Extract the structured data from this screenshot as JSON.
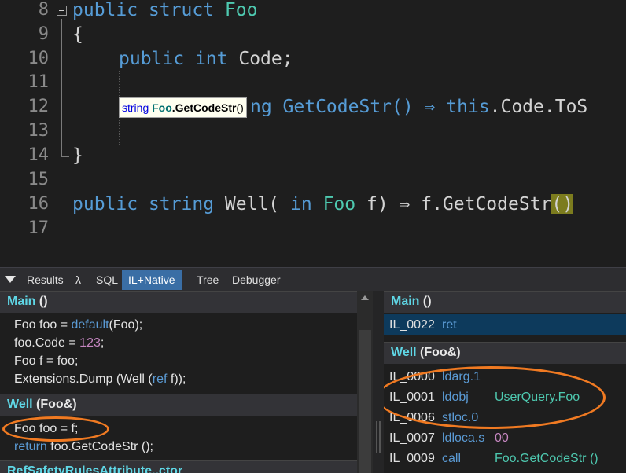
{
  "editor": {
    "line_numbers": [
      "8",
      "9",
      "10",
      "11",
      "12",
      "13",
      "14",
      "15",
      "16",
      "17"
    ],
    "line8": {
      "kw1": "public",
      "kw2": "struct",
      "type": "Foo"
    },
    "line9": {
      "brace": "{"
    },
    "line10": {
      "kw1": "public",
      "kw2": "int",
      "rest": "Code;"
    },
    "line12": {
      "visible": "ng GetCodeStr() ⇒ ",
      "kw": "this",
      "rest": ".Code.ToS"
    },
    "line14": {
      "brace": "}"
    },
    "line16": {
      "kw1": "public",
      "kw2": "string",
      "name": "Well(",
      "kw3": "in",
      "type": "Foo",
      "rest": "f) ⇒ f.GetCodeStr",
      "paren": "()"
    },
    "tooltip": {
      "kw": "string",
      "type": "Foo",
      "method": ".GetCodeStr",
      "parens": "()"
    }
  },
  "tabbar": {
    "tabs": [
      {
        "label": "Results"
      },
      {
        "label": "λ"
      },
      {
        "label": "SQL"
      },
      {
        "label": "IL+Native",
        "active": true
      },
      {
        "label": "Tree"
      },
      {
        "label": "Debugger"
      }
    ]
  },
  "left": {
    "main_header": {
      "name": "Main",
      "suffix": " ()"
    },
    "main_lines": [
      {
        "a": "Foo foo = ",
        "k": "default",
        "b": "(Foo);"
      },
      {
        "a": "foo.Code = ",
        "n": "123",
        "b": ";"
      },
      {
        "a": "Foo f = foo;"
      },
      {
        "a": "Extensions.Dump (Well (",
        "k": "ref",
        "b": " f));"
      }
    ],
    "well_header": {
      "name": "Well",
      "suffix": " (Foo&)"
    },
    "well_lines": [
      {
        "a": "Foo foo = f;"
      },
      {
        "k": "return",
        "b": " foo.GetCodeStr ();"
      }
    ],
    "next_header": "RefSafetyRulesAttribute..ctor"
  },
  "right": {
    "main_header": {
      "name": "Main",
      "suffix": " ()"
    },
    "main_rows": [
      {
        "off": "IL_0022",
        "op": "ret",
        "arg": ""
      }
    ],
    "well_header": {
      "name": "Well",
      "suffix": " (Foo&)"
    },
    "well_rows": [
      {
        "off": "IL_0000",
        "op": "ldarg.1",
        "arg": ""
      },
      {
        "off": "IL_0001",
        "op": "ldobj",
        "arg": "UserQuery.Foo"
      },
      {
        "off": "IL_0006",
        "op": "stloc.0",
        "arg": ""
      },
      {
        "off": "IL_0007",
        "op": "ldloca.s",
        "arg": "00"
      },
      {
        "off": "IL_0009",
        "op": "call",
        "arg": "Foo.GetCodeStr ()"
      }
    ]
  },
  "colors": {
    "highlight": "#f07a22",
    "accent": "#3a6ea5",
    "section_title": "#5fd7e6"
  }
}
